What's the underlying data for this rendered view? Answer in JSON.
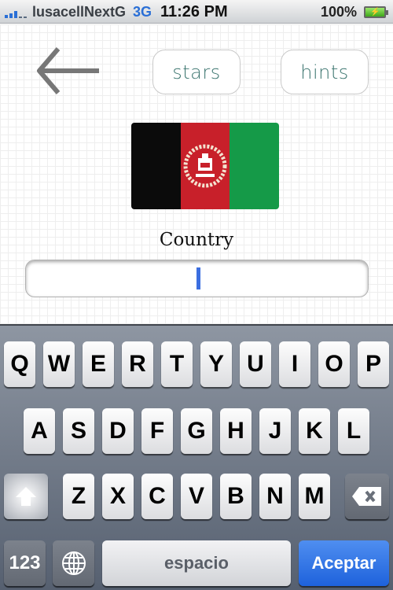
{
  "status_bar": {
    "carrier": "lusacellNextG",
    "network": "3G",
    "time": "11:26 PM",
    "battery_percent": "100%",
    "signal_bars": 3,
    "signal_bars_total": 5,
    "charging": true
  },
  "header": {
    "back_icon": "arrow-left-icon",
    "stars_label": "stars",
    "hints_label": "hints"
  },
  "flag": {
    "country": "Afghanistan",
    "colors": [
      "#0b0b0b",
      "#c8202a",
      "#159a48"
    ]
  },
  "answer": {
    "label": "Country",
    "value": ""
  },
  "keyboard": {
    "row1": [
      "Q",
      "W",
      "E",
      "R",
      "T",
      "Y",
      "U",
      "I",
      "O",
      "P"
    ],
    "row2": [
      "A",
      "S",
      "D",
      "F",
      "G",
      "H",
      "J",
      "K",
      "L"
    ],
    "row3": [
      "Z",
      "X",
      "C",
      "V",
      "B",
      "N",
      "M"
    ],
    "numbers_label": "123",
    "space_label": "espacio",
    "return_label": "Aceptar",
    "shift_icon": "shift-arrow-icon",
    "delete_icon": "backspace-icon",
    "globe_icon": "globe-icon"
  }
}
